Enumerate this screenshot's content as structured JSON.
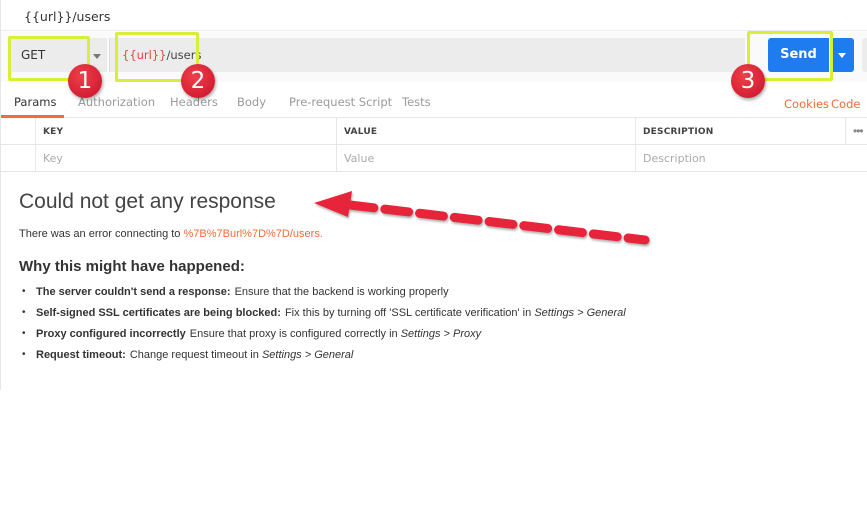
{
  "request": {
    "tab_title": "{{url}}/users",
    "method": "GET",
    "url_variable": "{{url}}",
    "url_path": "/users",
    "send_label": "Send"
  },
  "request_tabs": {
    "items": [
      {
        "label": "Params",
        "active": true
      },
      {
        "label": "Authorization"
      },
      {
        "label": "Headers"
      },
      {
        "label": "Body"
      },
      {
        "label": "Pre-request Script"
      },
      {
        "label": "Tests"
      }
    ],
    "right_links": [
      "Cookies",
      "Code"
    ]
  },
  "params_table": {
    "headers": [
      "KEY",
      "VALUE",
      "DESCRIPTION"
    ],
    "placeholders": [
      "Key",
      "Value",
      "Description"
    ],
    "more_icon": "•••"
  },
  "response": {
    "title": "Could not get any response",
    "error_prefix": "There was an error connecting to",
    "error_url": "%7B%7Burl%7D%7D/users.",
    "why_heading": "Why this might have happened:",
    "reasons": [
      {
        "bold": "The server couldn't send a response:",
        "text": "Ensure that the backend is working properly",
        "italic": ""
      },
      {
        "bold": "Self-signed SSL certificates are being blocked:",
        "text": "Fix this by turning off 'SSL certificate verification' in",
        "italic": "Settings > General"
      },
      {
        "bold": "Proxy configured incorrectly",
        "text": "Ensure that proxy is configured correctly in",
        "italic": "Settings > Proxy"
      },
      {
        "bold": "Request timeout:",
        "text": "Change request timeout in",
        "italic": "Settings > General"
      }
    ]
  },
  "annotations": {
    "badges": [
      "1",
      "2",
      "3"
    ],
    "highlight_color": "#d9ef37",
    "badge_color": "#e21f35",
    "arrow_color": "#e8243a"
  }
}
